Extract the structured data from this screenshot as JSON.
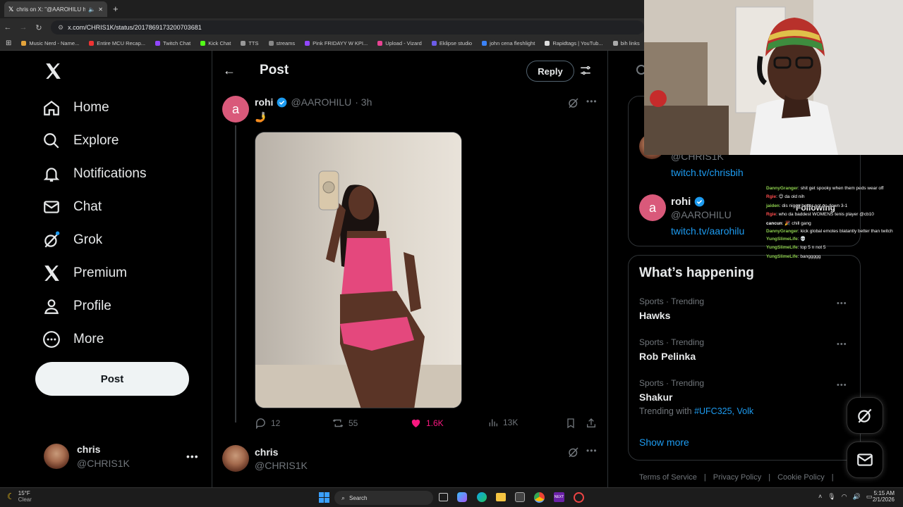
{
  "browser": {
    "tab_title": "chris on X: \"@AAROHILU h",
    "url": "x.com/CHRIS1K/status/2017869173200703681",
    "bookmarks": [
      "Music Nerd - Name...",
      "Entire MCU Recap...",
      "Twitch Chat",
      "Kick Chat",
      "TTS",
      "streams",
      "Pink FRIDAYY W KPI...",
      "Upload - Vizard",
      "Eklipse studio",
      "john cena fleshlight",
      "Rapidtags | YouTub...",
      "bih links"
    ]
  },
  "nav": {
    "items": [
      {
        "label": "Home",
        "icon": "home-icon"
      },
      {
        "label": "Explore",
        "icon": "search-icon"
      },
      {
        "label": "Notifications",
        "icon": "bell-icon"
      },
      {
        "label": "Chat",
        "icon": "mail-icon"
      },
      {
        "label": "Grok",
        "icon": "grok-icon"
      },
      {
        "label": "Premium",
        "icon": "x-logo-icon"
      },
      {
        "label": "Profile",
        "icon": "person-icon"
      },
      {
        "label": "More",
        "icon": "more-circle-icon"
      }
    ],
    "post_label": "Post",
    "account": {
      "name": "chris",
      "handle": "@CHRIS1K"
    }
  },
  "post": {
    "header_title": "Post",
    "reply_label": "Reply",
    "author_initial": "a",
    "author_name": "rohi",
    "author_handle": "@AAROHILU",
    "time": "· 3h",
    "text": "🤳",
    "stats": {
      "replies": "12",
      "reposts": "55",
      "likes": "1.6K",
      "views": "13K"
    },
    "reply_author": {
      "name": "chris",
      "handle": "@CHRIS1K"
    }
  },
  "sidebar": {
    "relevant_people": [
      {
        "handle": "@CHRIS1K",
        "link": "twitch.tv/chrisbih"
      },
      {
        "initial": "a",
        "name": "rohi",
        "handle": "@AAROHILU",
        "link": "twitch.tv/aarohilu",
        "follow_label": "Following"
      }
    ],
    "whats_happening_title": "What’s happening",
    "trends": [
      {
        "category": "Sports · Trending",
        "name": "Hawks"
      },
      {
        "category": "Sports · Trending",
        "name": "Rob Pelinka"
      },
      {
        "category": "Sports · Trending",
        "name": "Shakur",
        "trending_with_label": "Trending with",
        "trending_with": "#UFC325, Volk"
      }
    ],
    "show_more": "Show more",
    "footer_links": [
      "Terms of Service",
      "|",
      "Privacy Policy",
      "|",
      "Cookie Policy",
      "|"
    ]
  },
  "chat_overlay": [
    {
      "user": "DannyGranger",
      "msg": ": shit get spooky when them peds wear off"
    },
    {
      "user": "Rgie",
      "msg": ": 😊 da old nih",
      "red": true
    },
    {
      "user": "jaiden",
      "msg": ": dis nigga better not go down 3-1"
    },
    {
      "user": "Rgie",
      "msg": ": who da baddest WOMENS tenis player @cb10",
      "red": true
    },
    {
      "user": "cancun",
      "msg": ": 🎉 chill gang"
    },
    {
      "user": "DannyGranger",
      "msg": ": kick global emotes blatantly better than twitch"
    },
    {
      "user": "YungSlimeLife",
      "msg": ": 💀"
    },
    {
      "user": "YungSlimeLife",
      "msg": ": top 5 n not 5"
    },
    {
      "user": "YungSlimeLife",
      "msg": ": banggggg"
    }
  ],
  "taskbar": {
    "weather_temp": "15°F",
    "weather_desc": "Clear",
    "search_label": "Search",
    "time": "5:15 AM",
    "date": "2/1/2026"
  },
  "colors": {
    "accent": "#1d9bf0",
    "like": "#f91880",
    "avatar_pink": "#d9597a"
  }
}
